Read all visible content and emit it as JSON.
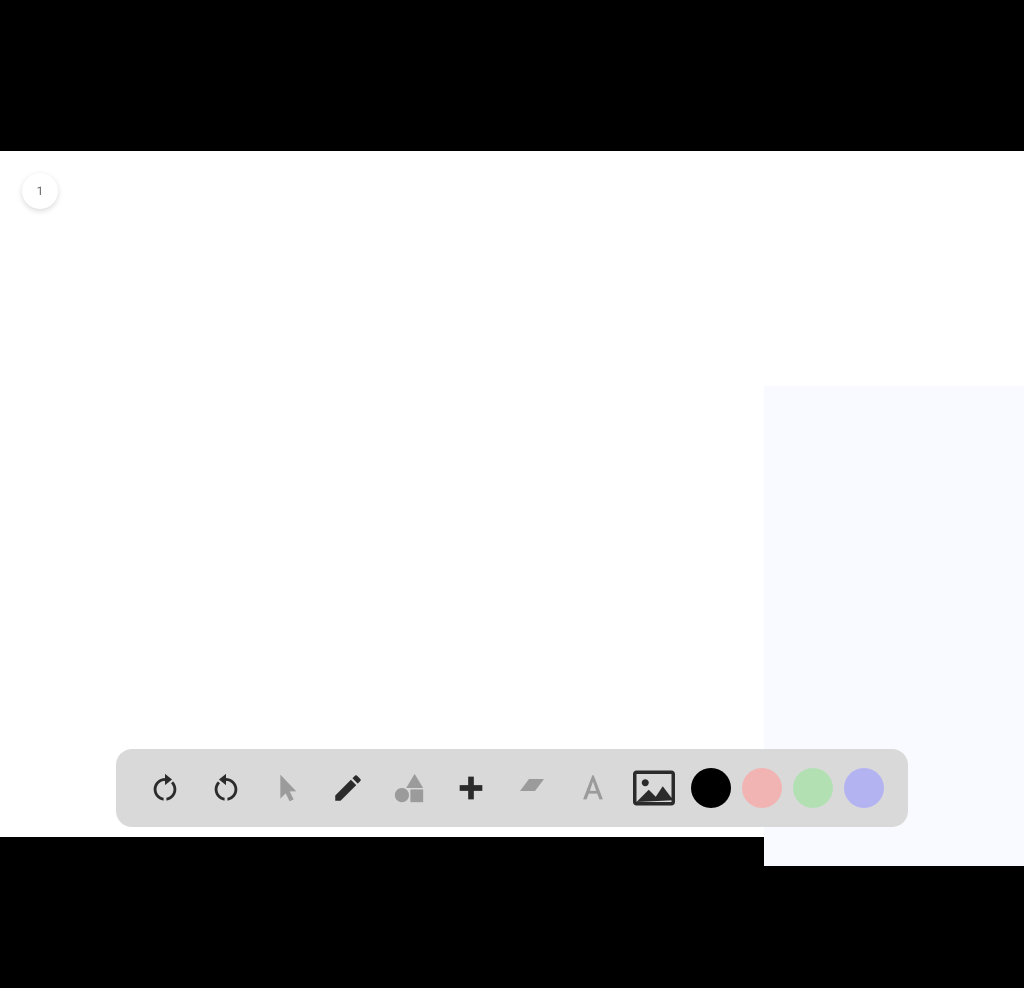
{
  "user_count": "1",
  "toolbar": {
    "colors": {
      "black": "#000000",
      "red": "#f2b3b3",
      "green": "#b3e0b3",
      "blue": "#b3b3f2"
    }
  }
}
